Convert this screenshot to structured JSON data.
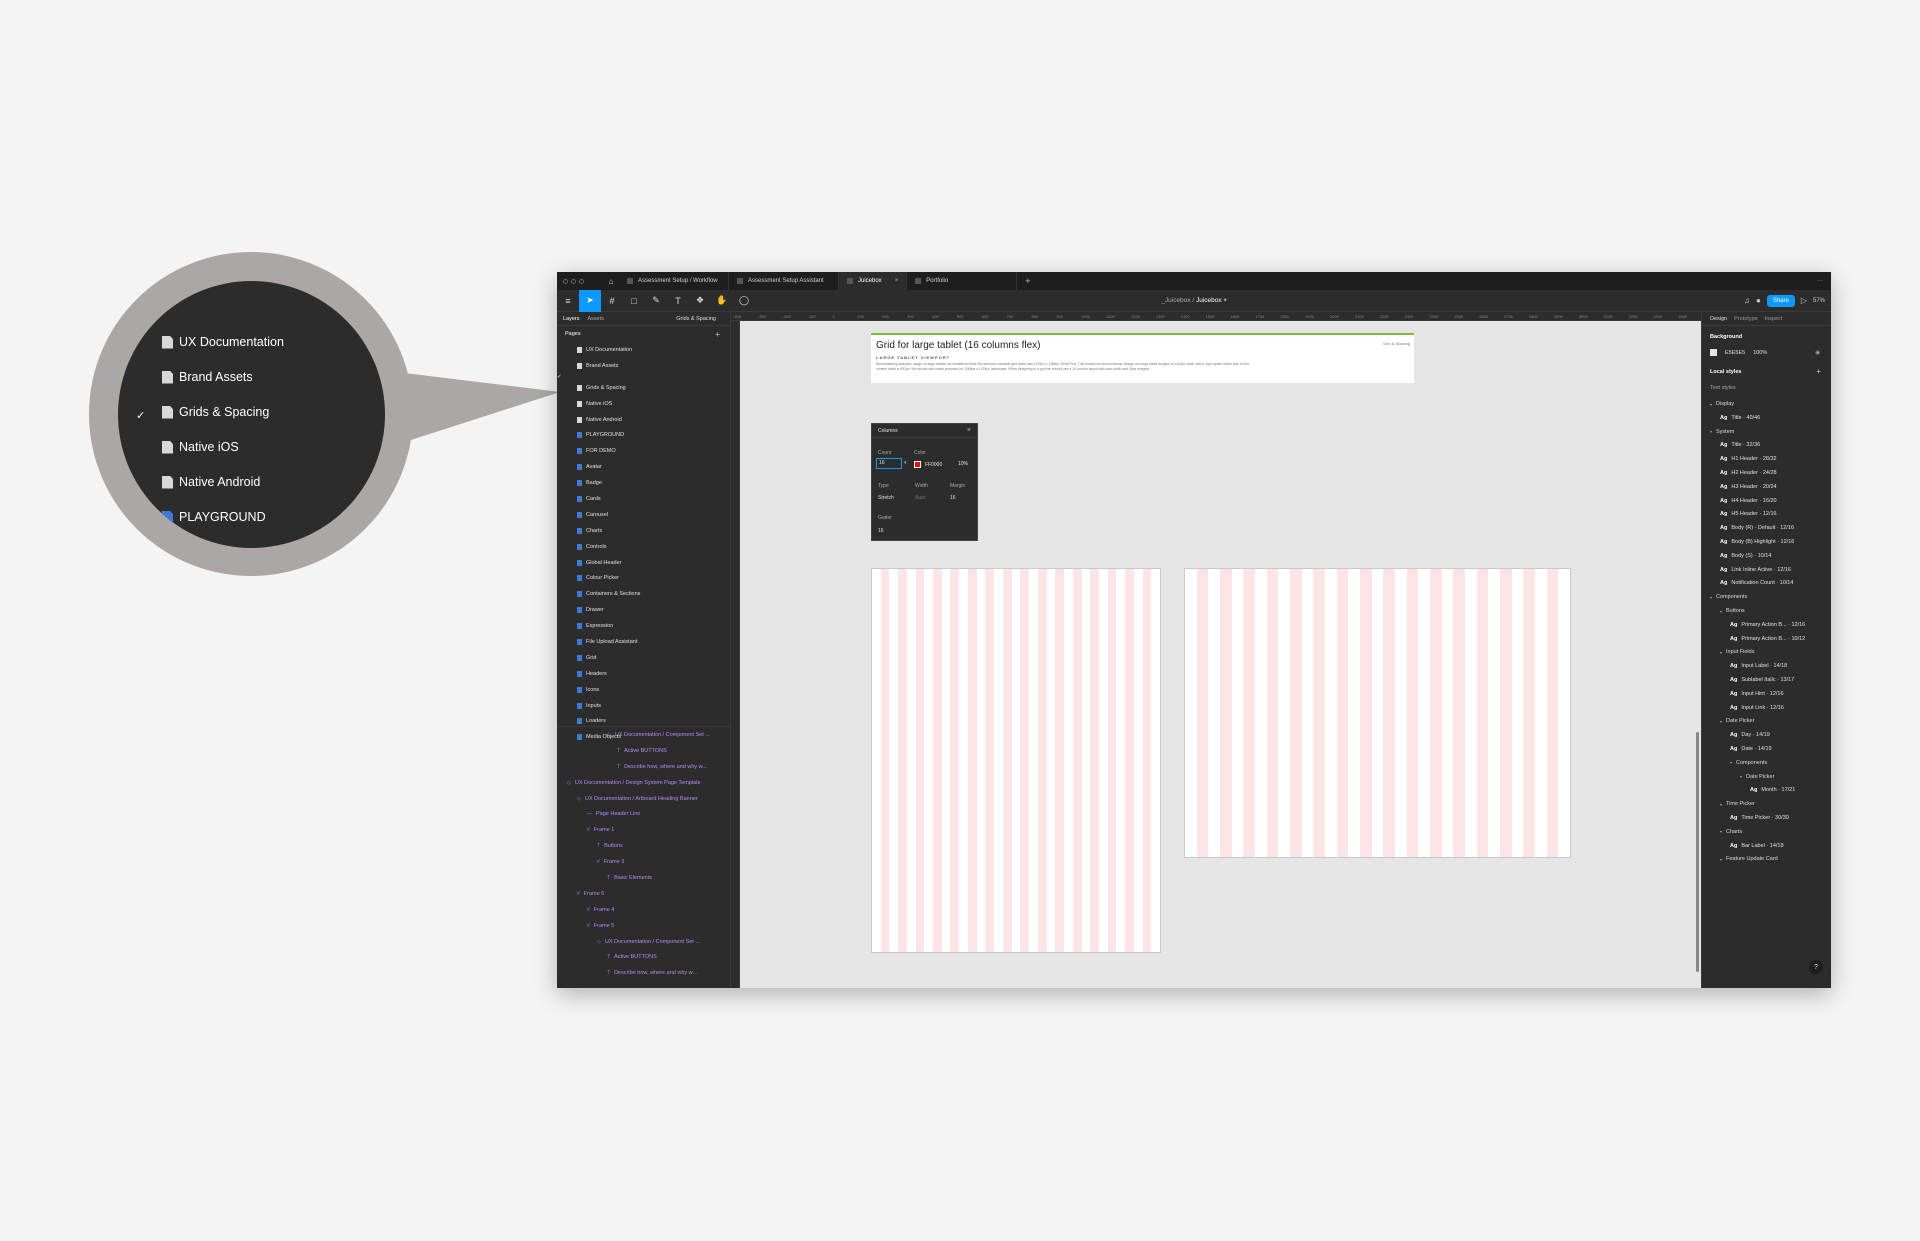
{
  "callout": {
    "items": [
      {
        "label": "UX Documentation",
        "checked": false,
        "icon": "page-icon"
      },
      {
        "label": "Brand Assets",
        "checked": false,
        "icon": "page-icon"
      },
      {
        "label": "Grids & Spacing",
        "checked": true,
        "icon": "page-icon"
      },
      {
        "label": "Native iOS",
        "checked": false,
        "icon": "page-icon"
      },
      {
        "label": "Native Android",
        "checked": false,
        "icon": "page-icon"
      },
      {
        "label": "PLAYGROUND",
        "checked": false,
        "icon": "page-icon-blue"
      }
    ],
    "check_glyph": "✓"
  },
  "tabs": [
    {
      "label": "Assessment Setup / Workflow",
      "active": false
    },
    {
      "label": "Assessment Setup Assistant",
      "active": false
    },
    {
      "label": "Juicebox",
      "active": true
    },
    {
      "label": "Portfolio",
      "active": false
    }
  ],
  "tab_add": "+",
  "tab_more": "···",
  "toolbar": {
    "breadcrumb_parent": "_Juicebox",
    "breadcrumb_sep": "/",
    "breadcrumb_file": "Juicebox",
    "share_label": "Share",
    "zoom": "57%"
  },
  "left_panel": {
    "tab_layers": "Layers",
    "tab_assets": "Assets",
    "page_selector": "Grids & Spacing",
    "pages_heading": "Pages",
    "pages": [
      {
        "label": "UX Documentation",
        "icon": "page-icon",
        "checked": false
      },
      {
        "label": "Brand Assets",
        "icon": "page-icon",
        "checked": false
      },
      {
        "label": "Grids & Spacing",
        "icon": "page-icon",
        "checked": true
      },
      {
        "label": "Native iOS",
        "icon": "page-icon",
        "checked": false
      },
      {
        "label": "Native Android",
        "icon": "page-icon",
        "checked": false
      },
      {
        "label": "PLAYGROUND",
        "icon": "page-icon-blue",
        "checked": false
      },
      {
        "label": "FOR DEMO",
        "icon": "page-icon-blue",
        "checked": false
      },
      {
        "label": "Avatar",
        "icon": "page-icon-blue",
        "checked": false
      },
      {
        "label": "Badge",
        "icon": "page-icon-blue",
        "checked": false
      },
      {
        "label": "Cards",
        "icon": "page-icon-blue",
        "checked": false
      },
      {
        "label": "Carousel",
        "icon": "page-icon-blue",
        "checked": false
      },
      {
        "label": "Charts",
        "icon": "page-icon-blue",
        "checked": false
      },
      {
        "label": "Controls",
        "icon": "page-icon-blue",
        "checked": false
      },
      {
        "label": "Global Header",
        "icon": "page-icon-blue",
        "checked": false
      },
      {
        "label": "Colour Picker",
        "icon": "page-icon-blue",
        "checked": false
      },
      {
        "label": "Containers & Sections",
        "icon": "page-icon-blue",
        "checked": false
      },
      {
        "label": "Drawer",
        "icon": "page-icon-blue",
        "checked": false
      },
      {
        "label": "Expression",
        "icon": "page-icon-blue",
        "checked": false
      },
      {
        "label": "File Upload Assistant",
        "icon": "page-icon-blue",
        "checked": false
      },
      {
        "label": "Grid",
        "icon": "page-icon-blue",
        "checked": false
      },
      {
        "label": "Headers",
        "icon": "page-icon-blue",
        "checked": false
      },
      {
        "label": "Icons",
        "icon": "page-icon-blue",
        "checked": false
      },
      {
        "label": "Inputs",
        "icon": "page-icon-blue",
        "checked": false
      },
      {
        "label": "Loaders",
        "icon": "page-icon-blue",
        "checked": false
      },
      {
        "label": "Media Objects",
        "icon": "page-icon-blue",
        "checked": false
      }
    ],
    "layers": [
      {
        "label": "UX Documentation / Component Set ...",
        "indent": 4,
        "icon": "component-icon"
      },
      {
        "label": "Active BUTTONS",
        "indent": 5,
        "icon": "text-icon"
      },
      {
        "label": "Describe how, where and why w...",
        "indent": 5,
        "icon": "text-icon"
      },
      {
        "label": "UX Documentation / Design System Page Template",
        "indent": 0,
        "icon": "component-icon"
      },
      {
        "label": "UX Documentation / Artboard Heading Banner",
        "indent": 1,
        "icon": "component-icon"
      },
      {
        "label": "Page Header Line",
        "indent": 2,
        "icon": "line-icon"
      },
      {
        "label": "Frame 1",
        "indent": 2,
        "icon": "frame-icon"
      },
      {
        "label": "Buttons",
        "indent": 3,
        "icon": "text-icon"
      },
      {
        "label": "Frame 3",
        "indent": 3,
        "icon": "frame-icon"
      },
      {
        "label": "Basic Elements",
        "indent": 4,
        "icon": "text-icon"
      },
      {
        "label": "Frame 6",
        "indent": 1,
        "icon": "frame-icon"
      },
      {
        "label": "Frame 4",
        "indent": 2,
        "icon": "frame-icon"
      },
      {
        "label": "Frame 5",
        "indent": 2,
        "icon": "frame-icon"
      },
      {
        "label": "UX Documentation / Component Set ...",
        "indent": 3,
        "icon": "component-icon"
      },
      {
        "label": "Active BUTTONS",
        "indent": 4,
        "icon": "text-icon"
      },
      {
        "label": "Describe how, where and why w...",
        "indent": 4,
        "icon": "text-icon"
      }
    ]
  },
  "canvas": {
    "ruler_ticks": [
      "-400",
      "-300",
      "-200",
      "-100",
      "0",
      "100",
      "200",
      "300",
      "400",
      "500",
      "600",
      "700",
      "800",
      "900",
      "1000",
      "1100",
      "1200",
      "1300",
      "1400",
      "1500",
      "1600",
      "1700",
      "1800",
      "1900",
      "2000",
      "2100",
      "2200",
      "2300",
      "2400",
      "2500",
      "2600",
      "2700",
      "2800",
      "2900",
      "3000",
      "3100",
      "3200",
      "3300",
      "3400"
    ],
    "doc_title": "Grid for large tablet (16 columns flex)",
    "doc_subtitle": "LARGE TABLET VIEWPORT",
    "doc_body": "Benchmarking analytics usage on large tablets we established that the minimum viewable grid width was 1024px x 1366px (iPad Pro). This means we should always design our large tablet designs at 1024px wide, with a 16px gutter either side so the content width is 992px. We should also make provision for 1366px x 1024px landscape. When designing to a grid we should use a 16 column layout with auto-width and 16px margins.",
    "doc_tag": "Grid & Spacing",
    "grid_dialog": {
      "title": "Columns",
      "count_label": "Count",
      "count_value": "16",
      "color_label": "Color",
      "color_hex": "FF0000",
      "color_opacity": "10%",
      "type_label": "Type",
      "type_value": "Stretch",
      "width_label": "Width",
      "width_value": "Auto",
      "margin_label": "Margin",
      "margin_value": "16",
      "gutter_label": "Gutter",
      "gutter_value": "16"
    }
  },
  "right_panel": {
    "tabs": [
      "Design",
      "Prototype",
      "Inspect"
    ],
    "background_heading": "Background",
    "background_hex": "E5E5E5",
    "background_opacity": "100%",
    "local_styles_heading": "Local styles",
    "text_styles_heading": "Text styles",
    "styles": [
      {
        "label": "Display",
        "kind": "group",
        "indent": 0
      },
      {
        "label": "Title · 40/46",
        "kind": "style",
        "indent": 1
      },
      {
        "label": "System",
        "kind": "group",
        "indent": 0
      },
      {
        "label": "Title · 32/36",
        "kind": "style",
        "indent": 1
      },
      {
        "label": "H1 Header · 28/32",
        "kind": "style",
        "indent": 1
      },
      {
        "label": "H2 Header · 24/28",
        "kind": "style",
        "indent": 1
      },
      {
        "label": "H3 Header · 20/24",
        "kind": "style",
        "indent": 1
      },
      {
        "label": "H4 Header · 16/20",
        "kind": "style",
        "indent": 1
      },
      {
        "label": "H5 Header · 12/16",
        "kind": "style",
        "indent": 1
      },
      {
        "label": "Body (R) - Default · 12/16",
        "kind": "style",
        "indent": 1
      },
      {
        "label": "Body (B) Highlight · 12/16",
        "kind": "style",
        "indent": 1
      },
      {
        "label": "Body (S) · 10/14",
        "kind": "style",
        "indent": 1
      },
      {
        "label": "Link Inline Active · 12/16",
        "kind": "style",
        "indent": 1
      },
      {
        "label": "Notification Count · 10/14",
        "kind": "style",
        "indent": 1
      },
      {
        "label": "Components",
        "kind": "group",
        "indent": 0
      },
      {
        "label": "Buttons",
        "kind": "group",
        "indent": 1
      },
      {
        "label": "Primary Action B... · 12/16",
        "kind": "style",
        "indent": 2
      },
      {
        "label": "Primary Action B... · 10/12",
        "kind": "style",
        "indent": 2
      },
      {
        "label": "Input Fields",
        "kind": "group",
        "indent": 1
      },
      {
        "label": "Input Label · 14/18",
        "kind": "style",
        "indent": 2
      },
      {
        "label": "Sublabel Italic · 13/17",
        "kind": "style",
        "indent": 2
      },
      {
        "label": "Input Hint · 12/16",
        "kind": "style",
        "indent": 2
      },
      {
        "label": "Input Link · 12/16",
        "kind": "style",
        "indent": 2
      },
      {
        "label": "Date Picker",
        "kind": "group",
        "indent": 1
      },
      {
        "label": "Day · 14/19",
        "kind": "style",
        "indent": 2
      },
      {
        "label": "Date · 14/19",
        "kind": "style",
        "indent": 2
      },
      {
        "label": "Components",
        "kind": "group",
        "indent": 2
      },
      {
        "label": "Date Picker",
        "kind": "group",
        "indent": 3
      },
      {
        "label": "Month · 17/21",
        "kind": "style",
        "indent": 4
      },
      {
        "label": "Time Picker",
        "kind": "group",
        "indent": 1
      },
      {
        "label": "Time Picker · 30/30",
        "kind": "style",
        "indent": 2
      },
      {
        "label": "Charts",
        "kind": "group",
        "indent": 1
      },
      {
        "label": "Bar Label · 14/18",
        "kind": "style",
        "indent": 2
      },
      {
        "label": "Feature Update Card",
        "kind": "group",
        "indent": 1
      }
    ],
    "ag_glyph": "Ag",
    "help": "?"
  },
  "colors": {
    "accent": "#0d99ff",
    "grid_column": "#fde4e4",
    "header_rule": "#7dbb3c"
  }
}
